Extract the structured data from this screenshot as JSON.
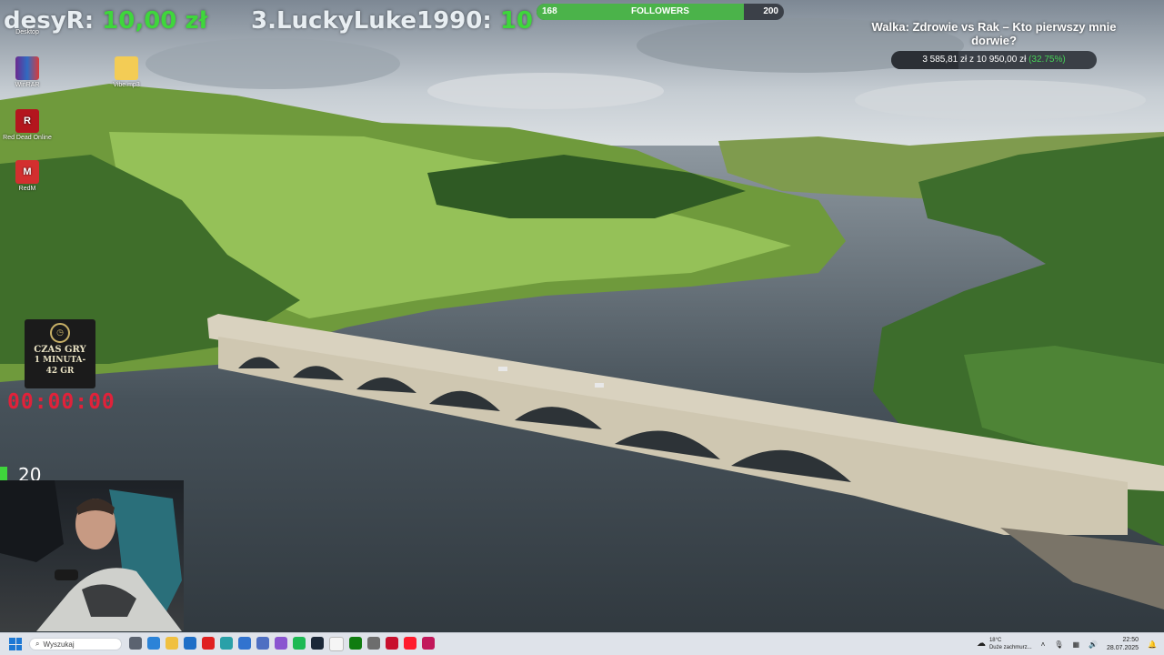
{
  "donors": {
    "first": {
      "name": "desyR:",
      "amount": "10,00 zł"
    },
    "third": {
      "name": "3.LuckyLuke1990:",
      "amount": "10"
    }
  },
  "followers": {
    "current": "168",
    "label": "FOLLOWERS",
    "target": "200",
    "progress": 0.84
  },
  "goal": {
    "title": "Walka: Zdrowie vs Rak – Kto pierwszy mnie dorwie?",
    "raised": "3 585,81 zł",
    "of": "z",
    "target": "10 950,00 zł",
    "percent": "(32.75%)",
    "progress": 0.3275
  },
  "desktop_icons": [
    {
      "label": "Desktop",
      "icon": "monitor-icon"
    },
    {
      "label": "WinRAR",
      "icon": "winrar-icon"
    },
    {
      "label": "Vibe.mp3",
      "icon": "folder-icon"
    },
    {
      "label": "Red Dead Online",
      "icon": "rdr-icon"
    },
    {
      "label": "RedM",
      "icon": "redm-icon"
    }
  ],
  "game_timer": {
    "title": "CZAS GRY",
    "line1": "1 MINUTA-",
    "line2": "42 GR",
    "time": "00:00:00"
  },
  "counter": {
    "value": "20"
  },
  "taskbar": {
    "search_placeholder": "Wyszukaj",
    "weather_temp": "18°C",
    "weather_desc": "Duże zachmurz...",
    "time": "22:50",
    "date": "28.07.2025"
  },
  "colors": {
    "accent_green": "#3fd63c",
    "timer_red": "#e0223a",
    "followers_fill": "#4bb34a"
  }
}
